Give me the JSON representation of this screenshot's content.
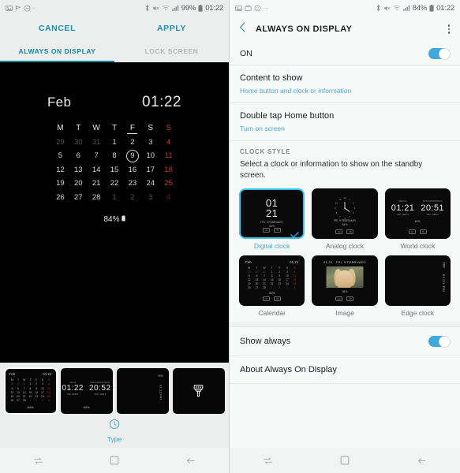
{
  "left_phone": {
    "status_bar": {
      "icons": [
        "image-icon",
        "flag-icon",
        "do-not-disturb-icon",
        "more-dots-icon"
      ],
      "bluetooth": "bluetooth-icon",
      "mute": "mute-icon",
      "wifi": "wifi-icon",
      "signal": "signal-icon",
      "battery_percent": "99%",
      "battery": "battery-icon",
      "time": "01:22"
    },
    "action_bar": {
      "cancel": "CANCEL",
      "apply": "APPLY"
    },
    "tabs": [
      {
        "label": "ALWAYS ON DISPLAY",
        "active": true
      },
      {
        "label": "LOCK SCREEN",
        "active": false
      }
    ],
    "preview": {
      "month": "Feb",
      "time": "01:22",
      "weekday_headers": [
        "M",
        "T",
        "W",
        "T",
        "F",
        "S",
        "S"
      ],
      "weeks": [
        [
          "29",
          "30",
          "31",
          "1",
          "2",
          "3",
          "4"
        ],
        [
          "5",
          "6",
          "7",
          "8",
          "9",
          "10",
          "11"
        ],
        [
          "12",
          "13",
          "14",
          "15",
          "16",
          "17",
          "18"
        ],
        [
          "19",
          "20",
          "21",
          "22",
          "23",
          "24",
          "25"
        ],
        [
          "26",
          "27",
          "28",
          "1",
          "2",
          "3",
          "4"
        ]
      ],
      "today": "9",
      "battery_text": "84%",
      "battery_icon": "battery-icon"
    },
    "thumbnails": [
      {
        "name": "calendar-style",
        "selected": true
      },
      {
        "name": "world-clock-style",
        "selected": false
      },
      {
        "name": "edge-clock-style",
        "selected": false
      },
      {
        "name": "brush-style",
        "selected": false
      }
    ],
    "thumb_calendar": {
      "month": "Feb",
      "time": "01:22",
      "battery": "84%"
    },
    "thumb_world": {
      "left_label": "Seoul",
      "left_time": "01:22",
      "left_sub": "FRI, FEB 9",
      "right_label": "SAN FRANCISCO",
      "right_time": "20:52",
      "right_sub": "THU, FEB 8",
      "battery": "84%"
    },
    "thumb_edge": {
      "top": "FEB",
      "vertical": "01:22 FRI"
    },
    "type_selector": {
      "icon": "clock-icon",
      "label": "Type"
    },
    "nav_bar": {
      "recents": "recents-icon",
      "home": "home-icon",
      "back": "back-icon"
    }
  },
  "right_phone": {
    "status_bar": {
      "icons": [
        "image-icon",
        "screenshot-icon",
        "emoji-icon",
        "more-dots-icon"
      ],
      "bluetooth": "bluetooth-icon",
      "mute": "mute-icon",
      "wifi": "wifi-icon",
      "signal": "signal-icon",
      "battery_percent": "84%",
      "battery": "battery-icon",
      "time": "01:22"
    },
    "app_bar": {
      "back_icon": "chevron-left-icon",
      "title": "ALWAYS ON DISPLAY",
      "menu_icon": "overflow-menu-icon"
    },
    "master_toggle": {
      "label": "ON",
      "value": true
    },
    "settings_items": [
      {
        "title": "Content to show",
        "subtitle": "Home button and clock or information"
      },
      {
        "title": "Double tap Home button",
        "subtitle": "Turn on screen"
      }
    ],
    "clock_style": {
      "section_title": "CLOCK STYLE",
      "description": "Select a clock or information to show on the standby screen.",
      "options": [
        {
          "label": "Digital clock",
          "selected": true
        },
        {
          "label": "Analog clock",
          "selected": false
        },
        {
          "label": "World clock",
          "selected": false
        },
        {
          "label": "Calendar",
          "selected": false
        },
        {
          "label": "Image",
          "selected": false
        },
        {
          "label": "Edge clock",
          "selected": false
        }
      ]
    },
    "digital_preview": {
      "hour": "01",
      "minute": "21",
      "sub_line1": "FRI, 9 FEBRUARY",
      "sub_line2": "84%"
    },
    "analog_preview": {
      "sub_line1": "FRI, 9 FEBRUARY",
      "sub_line2": "84%"
    },
    "world_preview": {
      "left_label": "SEOUL",
      "left_time": "01:21",
      "left_sub": "FRI, FEB 9",
      "right_label": "SAN FRANCISCO",
      "right_time": "20:51",
      "right_sub": "THU, FEB 8",
      "battery": "84%"
    },
    "calendar_preview": {
      "month": "Feb",
      "time": "01:21",
      "battery": "84%"
    },
    "image_preview": {
      "time": "01:21",
      "date": "FRI, 9 FEBRUARY",
      "battery": "84%"
    },
    "edge_preview": {
      "top": "FEB",
      "vertical": "01:21 FRI"
    },
    "show_always": {
      "label": "Show always",
      "value": true
    },
    "about_item": {
      "label": "About Always On Display"
    },
    "nav_bar": {
      "recents": "recents-icon",
      "home": "home-icon",
      "back": "back-icon"
    }
  },
  "colors": {
    "accent_blue": "#3fa9dd",
    "accent_teal": "#17859f",
    "selection_cyan": "#2ec5ef",
    "link_blue": "#4ea6c9",
    "sunday_red": "#c33a3a",
    "panel_bg": "#f7f8f8",
    "left_bg": "#eceded"
  }
}
